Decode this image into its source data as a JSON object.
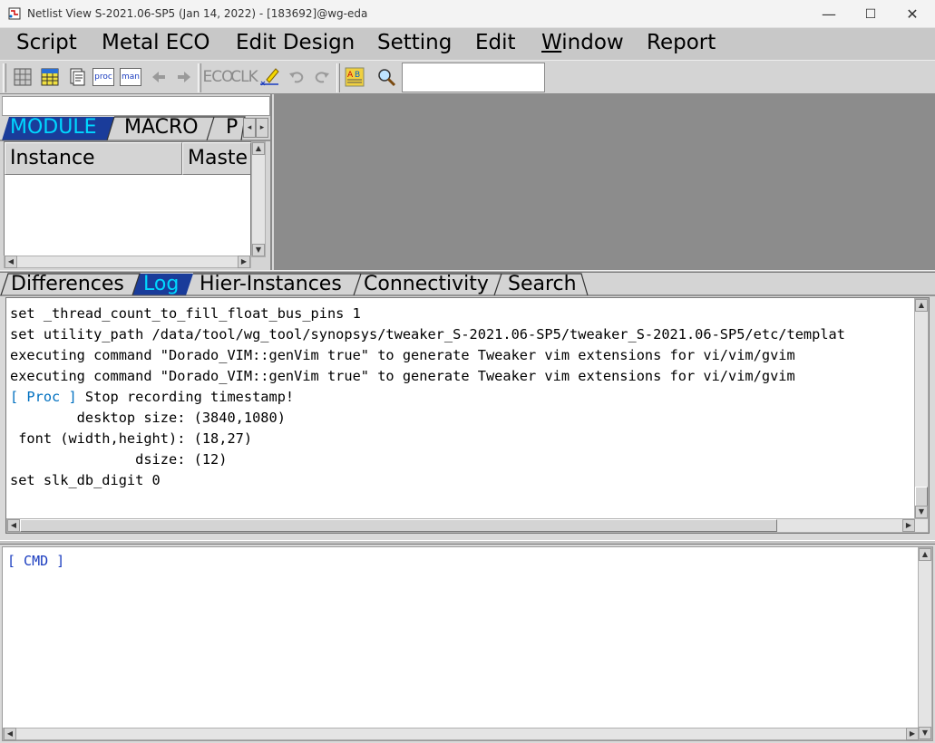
{
  "window": {
    "title": "Netlist View S-2021.06-SP5 (Jan 14, 2022)  - [183692]@wg-eda",
    "minimize": "—",
    "maximize": "☐",
    "close": "✕"
  },
  "menu": [
    "Script",
    "Metal ECO",
    "Edit Design",
    "Setting",
    "Edit",
    "Window",
    "Report"
  ],
  "menu_window_first": "W",
  "menu_window_rest": "indow",
  "toolbar": {
    "proc_label": "proc",
    "man_label": "man",
    "eco_label": "ECO",
    "clk_label": "CLK",
    "search_value": ""
  },
  "left_panel": {
    "filter_value": "",
    "tabs": [
      "MODULE",
      "MACRO",
      "P"
    ],
    "active_tab": "MODULE",
    "columns": [
      "Instance",
      "Maste"
    ]
  },
  "bottom_tabs": [
    "Differences",
    "Log",
    "Hier-Instances",
    "Connectivity",
    "Search"
  ],
  "active_bottom_tab": "Log",
  "log": {
    "lines": [
      {
        "tag": "",
        "text": "set _thread_count_to_fill_float_bus_pins 1"
      },
      {
        "tag": "",
        "text": "set utility_path /data/tool/wg_tool/synopsys/tweaker_S-2021.06-SP5/tweaker_S-2021.06-SP5/etc/templat"
      },
      {
        "tag": "",
        "text": "executing command \"Dorado_VIM::genVim true\" to generate Tweaker vim extensions for vi/vim/gvim"
      },
      {
        "tag": "",
        "text": "executing command \"Dorado_VIM::genVim true\" to generate Tweaker vim extensions for vi/vim/gvim"
      },
      {
        "tag": "[ Proc ]",
        "text": " Stop recording timestamp!"
      },
      {
        "tag": "",
        "text": "        desktop size: (3840,1080)"
      },
      {
        "tag": "",
        "text": " font (width,height): (18,27)"
      },
      {
        "tag": "",
        "text": "               dsize: (12)"
      },
      {
        "tag": "",
        "text": "set slk_db_digit 0"
      }
    ]
  },
  "cmd": {
    "prompt": "[ CMD ]"
  },
  "colors": {
    "active_tab": "#00d7ff",
    "canvas": "#8c8c8c",
    "proc_tag": "#0070c0",
    "cmd_prompt": "#1a3cbf"
  },
  "icons": [
    "app-icon",
    "grid-icon",
    "table-icon",
    "document-icon",
    "proc-icon",
    "man-icon",
    "back-arrow-icon",
    "forward-arrow-icon",
    "eco-icon",
    "clk-icon",
    "highlight-pen-icon",
    "undo-icon",
    "redo-icon",
    "text-color-icon",
    "magnifier-icon"
  ]
}
